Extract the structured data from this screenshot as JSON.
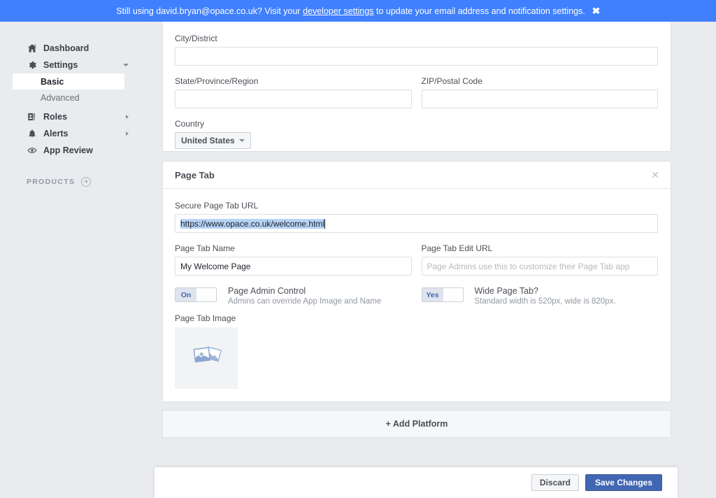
{
  "banner": {
    "text_before": "Still using david.bryan@opace.co.uk? Visit your ",
    "link": "developer settings",
    "text_after": " to update your email address and notification settings.",
    "close_icon": "close-icon",
    "background": "#4080ff"
  },
  "sidebar": {
    "items": [
      {
        "label": "Dashboard",
        "icon": "home-icon",
        "caret": "none"
      },
      {
        "label": "Settings",
        "icon": "gear-icon",
        "caret": "down"
      },
      {
        "label": "Roles",
        "icon": "roles-icon",
        "caret": "right"
      },
      {
        "label": "Alerts",
        "icon": "bell-icon",
        "caret": "right"
      },
      {
        "label": "App Review",
        "icon": "eye-icon",
        "caret": "none"
      }
    ],
    "settings_sub": [
      {
        "label": "Basic",
        "active": true
      },
      {
        "label": "Advanced",
        "active": false
      }
    ],
    "products": {
      "label": "PRODUCTS",
      "add_icon": "plus-circle-icon"
    }
  },
  "address_card": {
    "city": {
      "label": "City/District",
      "value": "",
      "placeholder": ""
    },
    "state": {
      "label": "State/Province/Region",
      "value": "",
      "placeholder": ""
    },
    "zip": {
      "label": "ZIP/Postal Code",
      "value": "",
      "placeholder": ""
    },
    "country": {
      "label": "Country",
      "value": "United States"
    }
  },
  "page_tab_card": {
    "title": "Page Tab",
    "close_icon": "close-icon",
    "secure_url": {
      "label": "Secure Page Tab URL",
      "value": "https://www.opace.co.uk/welcome.html",
      "selected": true
    },
    "tab_name": {
      "label": "Page Tab Name",
      "value": "My Welcome Page",
      "placeholder": ""
    },
    "edit_url": {
      "label": "Page Tab Edit URL",
      "value": "",
      "placeholder": "Page Admins use this to customize their Page Tab app"
    },
    "admin_control": {
      "state_label": "On",
      "title": "Page Admin Control",
      "subtitle": "Admins can override App Image and Name"
    },
    "wide_tab": {
      "state_label": "Yes",
      "title": "Wide Page Tab?",
      "subtitle": "Standard width is 520px, wide is 820px."
    },
    "image": {
      "label": "Page Tab Image",
      "icon": "photo-stack-add-icon"
    }
  },
  "add_platform": {
    "plus": "+",
    "label": "Add Platform"
  },
  "save_bar": {
    "discard_label": "Discard",
    "save_label": "Save Changes",
    "save_color": "#4267b2"
  }
}
